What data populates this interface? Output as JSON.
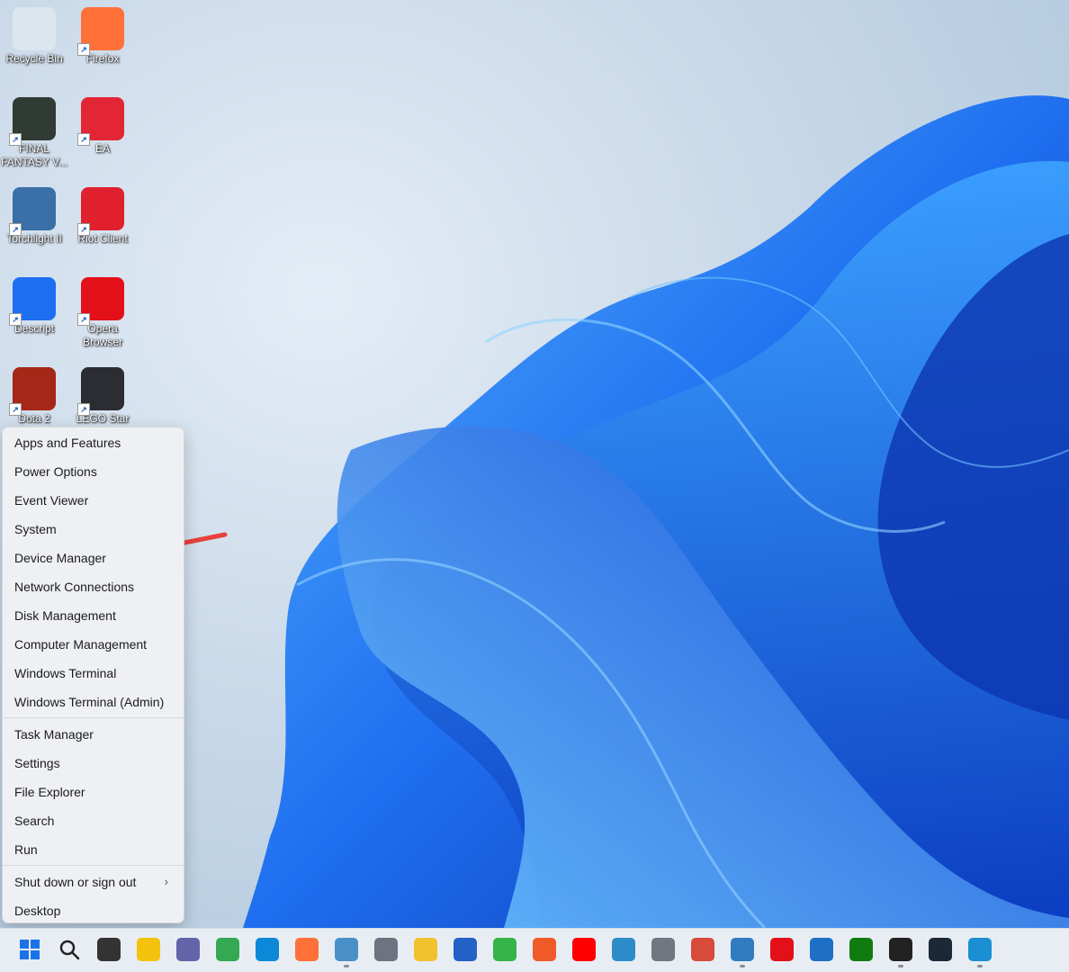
{
  "desktop_icons": [
    {
      "label": "Recycle Bin",
      "icon": "recycle-bin-icon",
      "color": "#dbe6ef"
    },
    {
      "label": "Firefox",
      "icon": "firefox-icon",
      "color": "#ff7139"
    },
    {
      "label": "FINAL FANTASY V...",
      "icon": "final-fantasy-icon",
      "color": "#2f3b33"
    },
    {
      "label": "EA",
      "icon": "ea-icon",
      "color": "#e32636"
    },
    {
      "label": "Torchlight II",
      "icon": "torchlight-icon",
      "color": "#3b6fa8"
    },
    {
      "label": "Riot Client",
      "icon": "riot-client-icon",
      "color": "#e0202c"
    },
    {
      "label": "Descript",
      "icon": "descript-icon",
      "color": "#1e6ff0"
    },
    {
      "label": "Opera Browser",
      "icon": "opera-icon",
      "color": "#e3101a"
    },
    {
      "label": "Dota 2",
      "icon": "dota2-icon",
      "color": "#a52717"
    },
    {
      "label": "LEGO Star",
      "icon": "lego-star-wars-icon",
      "color": "#2c2c33"
    }
  ],
  "menu": {
    "group1": [
      "Apps and Features",
      "Power Options",
      "Event Viewer",
      "System",
      "Device Manager",
      "Network Connections",
      "Disk Management",
      "Computer Management",
      "Windows Terminal",
      "Windows Terminal (Admin)"
    ],
    "group2": [
      "Task Manager",
      "Settings",
      "File Explorer",
      "Search",
      "Run"
    ],
    "group3": [
      {
        "label": "Shut down or sign out",
        "chevron": "›"
      },
      {
        "label": "Desktop"
      }
    ],
    "highlight_target": "Device Manager",
    "annotation_color": "#e8403a"
  },
  "taskbar": {
    "icons": [
      {
        "name": "start-icon",
        "color": "#1a73e8"
      },
      {
        "name": "search-icon",
        "color": "#2b2b2b"
      },
      {
        "name": "task-view-icon",
        "color": "#333333"
      },
      {
        "name": "widgets-icon",
        "color": "#f4c20d"
      },
      {
        "name": "teams-chat-icon",
        "color": "#6264a7"
      },
      {
        "name": "chrome-icon",
        "color": "#34a853"
      },
      {
        "name": "edge-icon",
        "color": "#0c88d8"
      },
      {
        "name": "firefox-icon",
        "color": "#ff7139"
      },
      {
        "name": "notepad-icon",
        "color": "#4a90c8"
      },
      {
        "name": "calculator-icon",
        "color": "#6b7480"
      },
      {
        "name": "file-explorer-icon",
        "color": "#f2c12e"
      },
      {
        "name": "microsoft-store-icon",
        "color": "#2461c7"
      },
      {
        "name": "camtasia-icon",
        "color": "#36b449"
      },
      {
        "name": "snagit-icon",
        "color": "#f05a28"
      },
      {
        "name": "youtube-icon",
        "color": "#ff0000"
      },
      {
        "name": "slack-icon",
        "color": "#2d8cc8"
      },
      {
        "name": "settings-icon",
        "color": "#707780"
      },
      {
        "name": "snipping-tool-icon",
        "color": "#d64b3a"
      },
      {
        "name": "sharex-icon",
        "color": "#2f7cc0"
      },
      {
        "name": "opera-icon",
        "color": "#e3101a"
      },
      {
        "name": "mail-icon",
        "color": "#1f6fc6"
      },
      {
        "name": "xbox-icon",
        "color": "#107c10"
      },
      {
        "name": "ryzen-master-icon",
        "color": "#222222"
      },
      {
        "name": "steam-icon",
        "color": "#1b2838"
      },
      {
        "name": "remote-desktop-icon",
        "color": "#1a8fd4"
      }
    ]
  }
}
